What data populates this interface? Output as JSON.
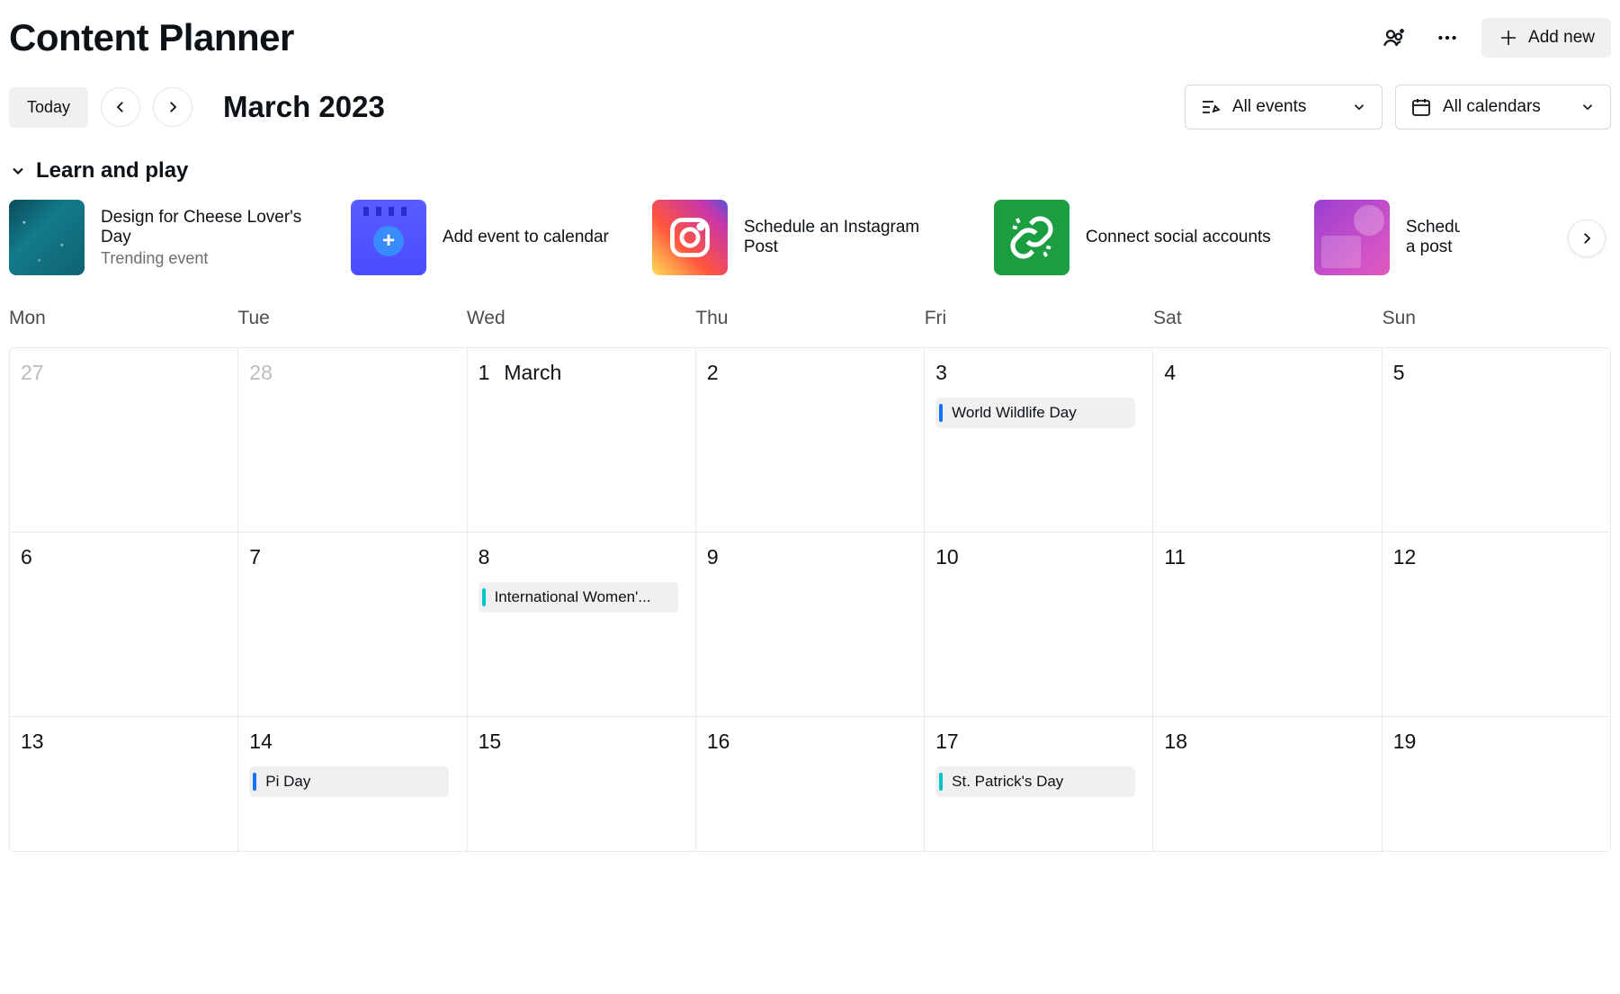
{
  "header": {
    "title": "Content Planner",
    "add_new": "Add new"
  },
  "toolbar": {
    "today": "Today",
    "month": "March 2023",
    "events_filter": "All events",
    "calendars_filter": "All calendars"
  },
  "section": {
    "title": "Learn and play"
  },
  "cards": [
    {
      "title": "Design for Cheese Lover's Day",
      "subtitle": "Trending event"
    },
    {
      "title": "Add event to calendar"
    },
    {
      "title": "Schedule an Instagram Post"
    },
    {
      "title": "Connect social accounts"
    },
    {
      "title": "Schedule a post"
    }
  ],
  "weekdays": [
    "Mon",
    "Tue",
    "Wed",
    "Thu",
    "Fri",
    "Sat",
    "Sun"
  ],
  "calendar": {
    "weeks": [
      [
        {
          "n": "27",
          "muted": true
        },
        {
          "n": "28",
          "muted": true
        },
        {
          "n": "1",
          "month": "March"
        },
        {
          "n": "2"
        },
        {
          "n": "3",
          "event": {
            "label": "World Wildlife Day",
            "color": "blue"
          }
        },
        {
          "n": "4"
        },
        {
          "n": "5"
        }
      ],
      [
        {
          "n": "6"
        },
        {
          "n": "7"
        },
        {
          "n": "8",
          "event": {
            "label": "International Women'...",
            "color": "teal"
          }
        },
        {
          "n": "9"
        },
        {
          "n": "10"
        },
        {
          "n": "11"
        },
        {
          "n": "12"
        }
      ],
      [
        {
          "n": "13"
        },
        {
          "n": "14",
          "event": {
            "label": "Pi Day",
            "color": "blue"
          }
        },
        {
          "n": "15"
        },
        {
          "n": "16"
        },
        {
          "n": "17",
          "event": {
            "label": "St. Patrick's Day",
            "color": "teal"
          }
        },
        {
          "n": "18"
        },
        {
          "n": "19"
        }
      ]
    ]
  }
}
